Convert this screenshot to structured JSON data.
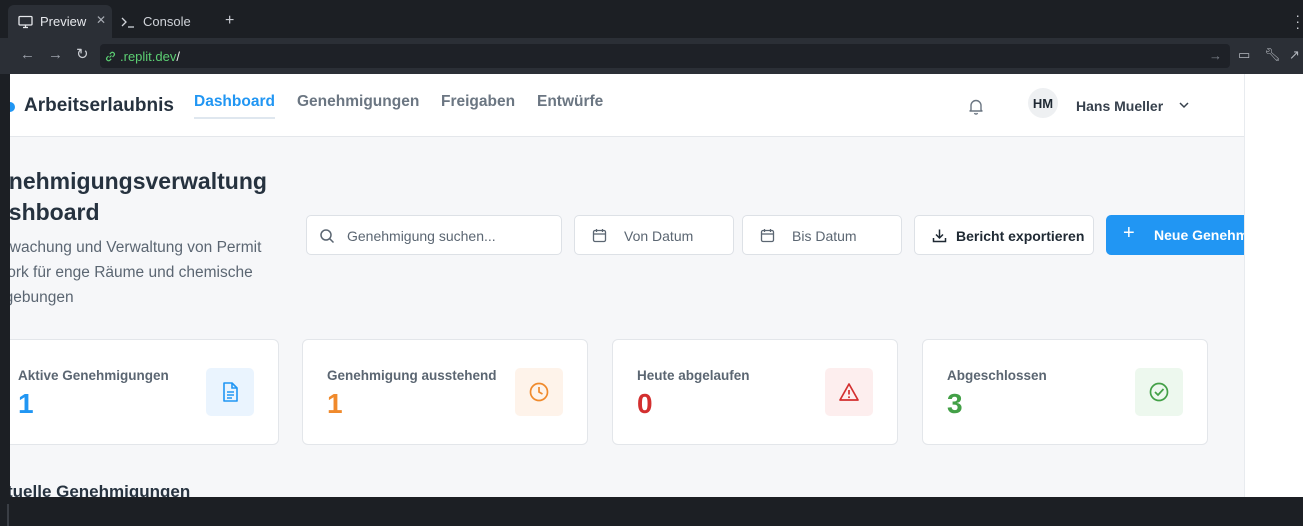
{
  "browser": {
    "tabs": [
      {
        "label": "Preview",
        "icon": "monitor-icon",
        "active": true
      },
      {
        "label": "Console",
        "icon": "terminal-icon",
        "active": false
      }
    ],
    "url_host": ".replit.dev",
    "url_path": "/"
  },
  "app": {
    "brand": "Arbeitserlaubnis",
    "nav": [
      {
        "label": "Dashboard",
        "active": true
      },
      {
        "label": "Genehmigungen",
        "active": false
      },
      {
        "label": "Freigaben",
        "active": false
      },
      {
        "label": "Entwürfe",
        "active": false
      }
    ],
    "user": {
      "initials": "HM",
      "name": "Hans Mueller"
    }
  },
  "page": {
    "title_line1": "enehmigungsverwaltung",
    "title_line2": "ashboard",
    "subtitle_line1": "erwachung und Verwaltung von Permit",
    "subtitle_line2": "work für enge Räume und chemische",
    "subtitle_line3": "ngebungen"
  },
  "toolbar": {
    "search_placeholder": "Genehmigung suchen...",
    "from_date": "Von Datum",
    "to_date": "Bis Datum",
    "export_label": "Bericht exportieren",
    "new_label": "Neue Genehmigung"
  },
  "stats": [
    {
      "label": "Aktive Genehmigungen",
      "value": "1",
      "color": "#2196f3",
      "icon": "document-icon",
      "icon_bg": "#eaf4fe"
    },
    {
      "label": "Genehmigung ausstehend",
      "value": "1",
      "color": "#f08a2c",
      "icon": "clock-icon",
      "icon_bg": "#fef3ea"
    },
    {
      "label": "Heute abgelaufen",
      "value": "0",
      "color": "#d32f2f",
      "icon": "warning-icon",
      "icon_bg": "#fdeeee"
    },
    {
      "label": "Abgeschlossen",
      "value": "3",
      "color": "#43a047",
      "icon": "check-circle-icon",
      "icon_bg": "#edf8ee"
    }
  ],
  "section": {
    "title": "tuelle Genehmigungen"
  }
}
